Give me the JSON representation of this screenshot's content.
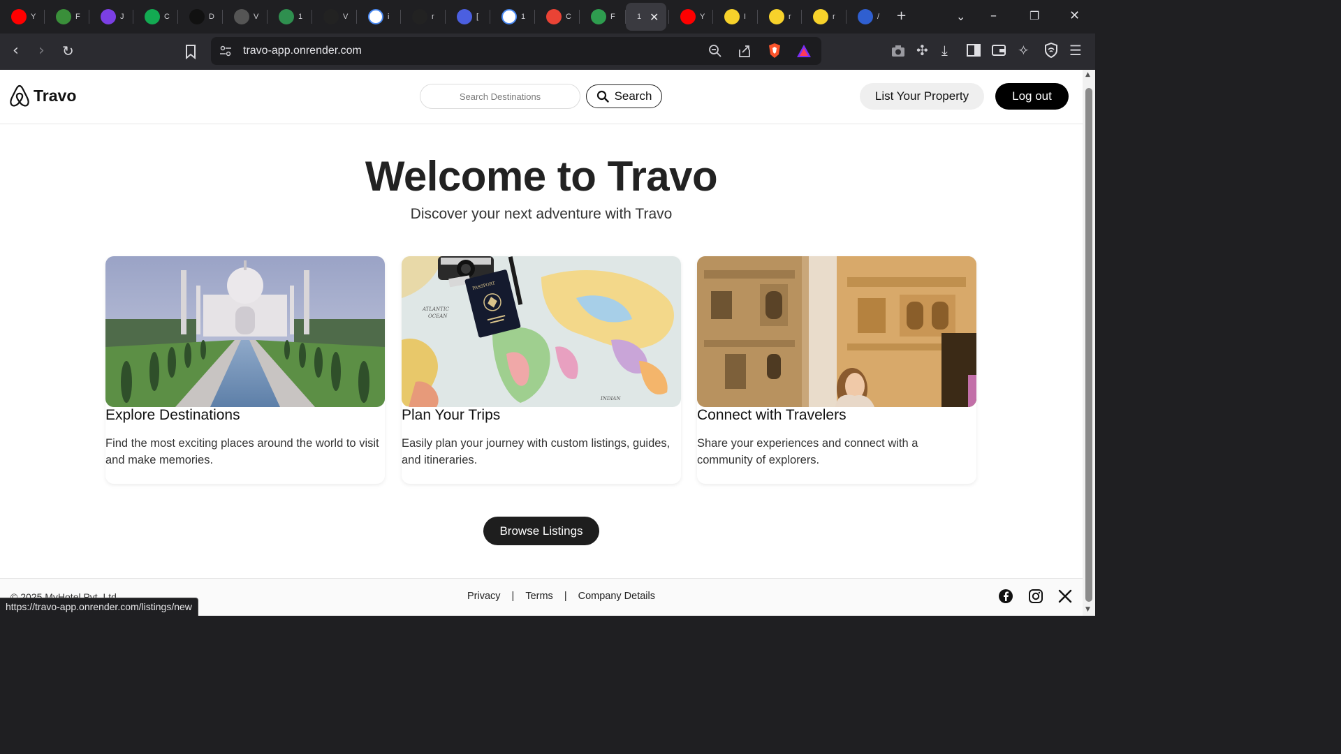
{
  "browser": {
    "tabs": [
      {
        "icon": "youtube-icon",
        "color": "#ff0000",
        "title": "Y"
      },
      {
        "icon": "leaf-icon",
        "color": "#3a8f3a",
        "title": "F"
      },
      {
        "icon": "star-icon",
        "color": "#7b3fe4",
        "title": "J"
      },
      {
        "icon": "mongodb-icon",
        "color": "#13aa52",
        "title": "C"
      },
      {
        "icon": "circle-icon",
        "color": "#111111",
        "title": "D"
      },
      {
        "icon": "chatgpt-icon",
        "color": "#555555",
        "title": "V"
      },
      {
        "icon": "px-icon",
        "color": "#2f8f4f",
        "title": "1"
      },
      {
        "icon": "is-icon",
        "color": "#222222",
        "title": "V"
      },
      {
        "icon": "google-icon",
        "color": "#ffffff",
        "title": "i"
      },
      {
        "icon": "github-icon",
        "color": "#222222",
        "title": "r"
      },
      {
        "icon": "vite-icon",
        "color": "#4b5fe0",
        "title": "["
      },
      {
        "icon": "openai-icon",
        "color": "#ffffff",
        "title": "1"
      },
      {
        "icon": "gmail-icon",
        "color": "#ea4335",
        "title": "C"
      },
      {
        "icon": "check-icon",
        "color": "#2e9d4f",
        "title": "F"
      },
      {
        "icon": "active-tab",
        "color": "#3a3a40",
        "title": "1"
      },
      {
        "icon": "youtube-icon",
        "color": "#ff0000",
        "title": "Y"
      },
      {
        "icon": "flipkart-icon",
        "color": "#f7d22b",
        "title": "I"
      },
      {
        "icon": "flipkart-icon",
        "color": "#f7d22b",
        "title": "r"
      },
      {
        "icon": "flipkart-icon",
        "color": "#f7d22b",
        "title": "r"
      },
      {
        "icon": "bank-icon",
        "color": "#2f5fd0",
        "title": "/"
      }
    ],
    "url": "travo-app.onrender.com",
    "status_url": "https://travo-app.onrender.com/listings/new"
  },
  "navbar": {
    "brand": "Travo",
    "search_placeholder": "Search Destinations",
    "search_button": "Search",
    "list_property": "List Your Property",
    "logout": "Log out"
  },
  "hero": {
    "title": "Welcome to Travo",
    "subtitle": "Discover your next adventure with Travo"
  },
  "cards": [
    {
      "title": "Explore Destinations",
      "text": "Find the most exciting places around the world to visit and make memories."
    },
    {
      "title": "Plan Your Trips",
      "text": "Easily plan your journey with custom listings, guides, and itineraries."
    },
    {
      "title": "Connect with Travelers",
      "text": "Share your experiences and connect with a community of explorers."
    }
  ],
  "browse_button": "Browse Listings",
  "footer": {
    "copyright": "© 2025 MyHotel Pvt. Ltd.",
    "links": [
      "Privacy",
      "Terms",
      "Company Details"
    ],
    "separator": "|"
  },
  "colors": {
    "primary": "#000000",
    "browse_button": "#1e1e1e",
    "list_button_bg": "#efefef"
  }
}
